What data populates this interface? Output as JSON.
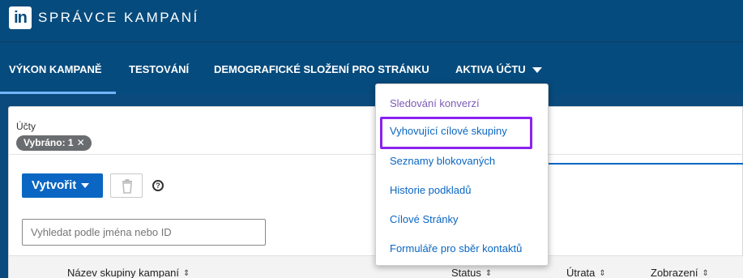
{
  "header": {
    "logo_text": "in",
    "app_title": "SPRÁVCE KAMPANÍ"
  },
  "tabs": [
    {
      "label": "VÝKON KAMPANĚ",
      "active": true
    },
    {
      "label": "TESTOVÁNÍ",
      "active": false
    },
    {
      "label": "DEMOGRAFICKÉ SLOŽENÍ PRO STRÁNKU",
      "active": false
    },
    {
      "label": "AKTIVA ÚČTU",
      "active": false
    }
  ],
  "filters": {
    "accounts_label": "Účty",
    "selected_chip": "Vybráno: 1",
    "chip_close": "✕"
  },
  "toolbar": {
    "create_label": "Vytvořit",
    "help_symbol": "?"
  },
  "search": {
    "placeholder": "Vyhledat podle jména nebo ID"
  },
  "table": {
    "columns": [
      "Název skupiny kampaní",
      "Status",
      "Útrata",
      "Zobrazení"
    ]
  },
  "dropdown": {
    "items": [
      "Sledování konverzí",
      "Vyhovující cílové skupiny",
      "Seznamy blokovaných",
      "Historie podkladů",
      "Cílové Stránky",
      "Formuláře pro sběr kontaktů"
    ],
    "highlight_color": "#8a22f0"
  }
}
